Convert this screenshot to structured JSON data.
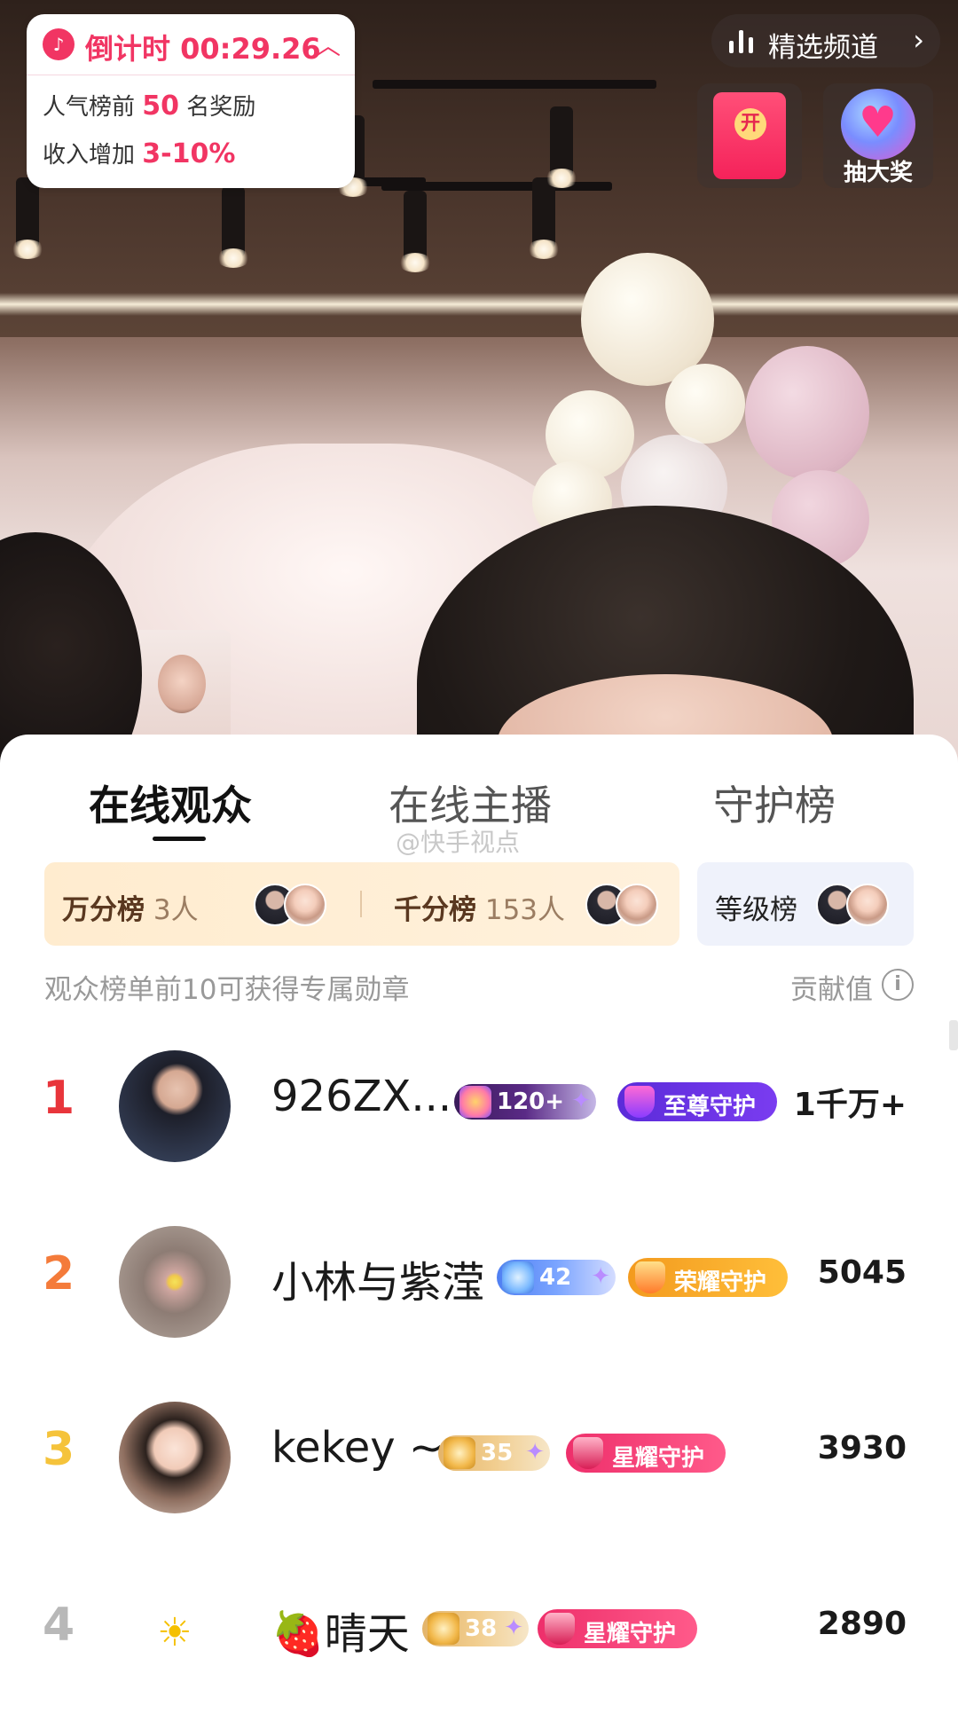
{
  "countdown": {
    "label": "倒计时 00:29.26",
    "line1_prefix": "人气榜前",
    "line1_highlight": "50",
    "line1_suffix": "名奖励",
    "line2_prefix": "收入增加",
    "line2_highlight": "3-10%"
  },
  "channel": {
    "label": "精选频道"
  },
  "lottery": {
    "label": "抽大奖"
  },
  "redpack": {
    "label": "开"
  },
  "tabs": [
    {
      "label": "在线观众",
      "active": true
    },
    {
      "label": "在线主播",
      "active": false
    },
    {
      "label": "守护榜",
      "active": false
    }
  ],
  "watermark": "@快手视点",
  "boards": {
    "wan_label": "万分榜",
    "wan_count": "3人",
    "qian_label": "千分榜",
    "qian_count": "153人",
    "level_label": "等级榜"
  },
  "hint": "观众榜单前10可获得专属勋章",
  "contribution_label": "贡献值",
  "colors": {
    "accent": "#f13563",
    "rank1": "#e8353b",
    "rank2": "#f47b3a",
    "rank3": "#f5c33b",
    "rank_other": "#b8b8b8"
  },
  "viewers": [
    {
      "rank": "1",
      "name": "926ZX...",
      "level": "120+",
      "guard": "至尊守护",
      "score": "1千万+"
    },
    {
      "rank": "2",
      "name": "小林与紫滢",
      "level": "42",
      "guard": "荣耀守护",
      "score": "5045"
    },
    {
      "rank": "3",
      "name": "kekey ~",
      "level": "35",
      "guard": "星耀守护",
      "score": "3930"
    },
    {
      "rank": "4",
      "name": "晴天",
      "level": "38",
      "guard": "星耀守护",
      "score": "2890"
    }
  ]
}
